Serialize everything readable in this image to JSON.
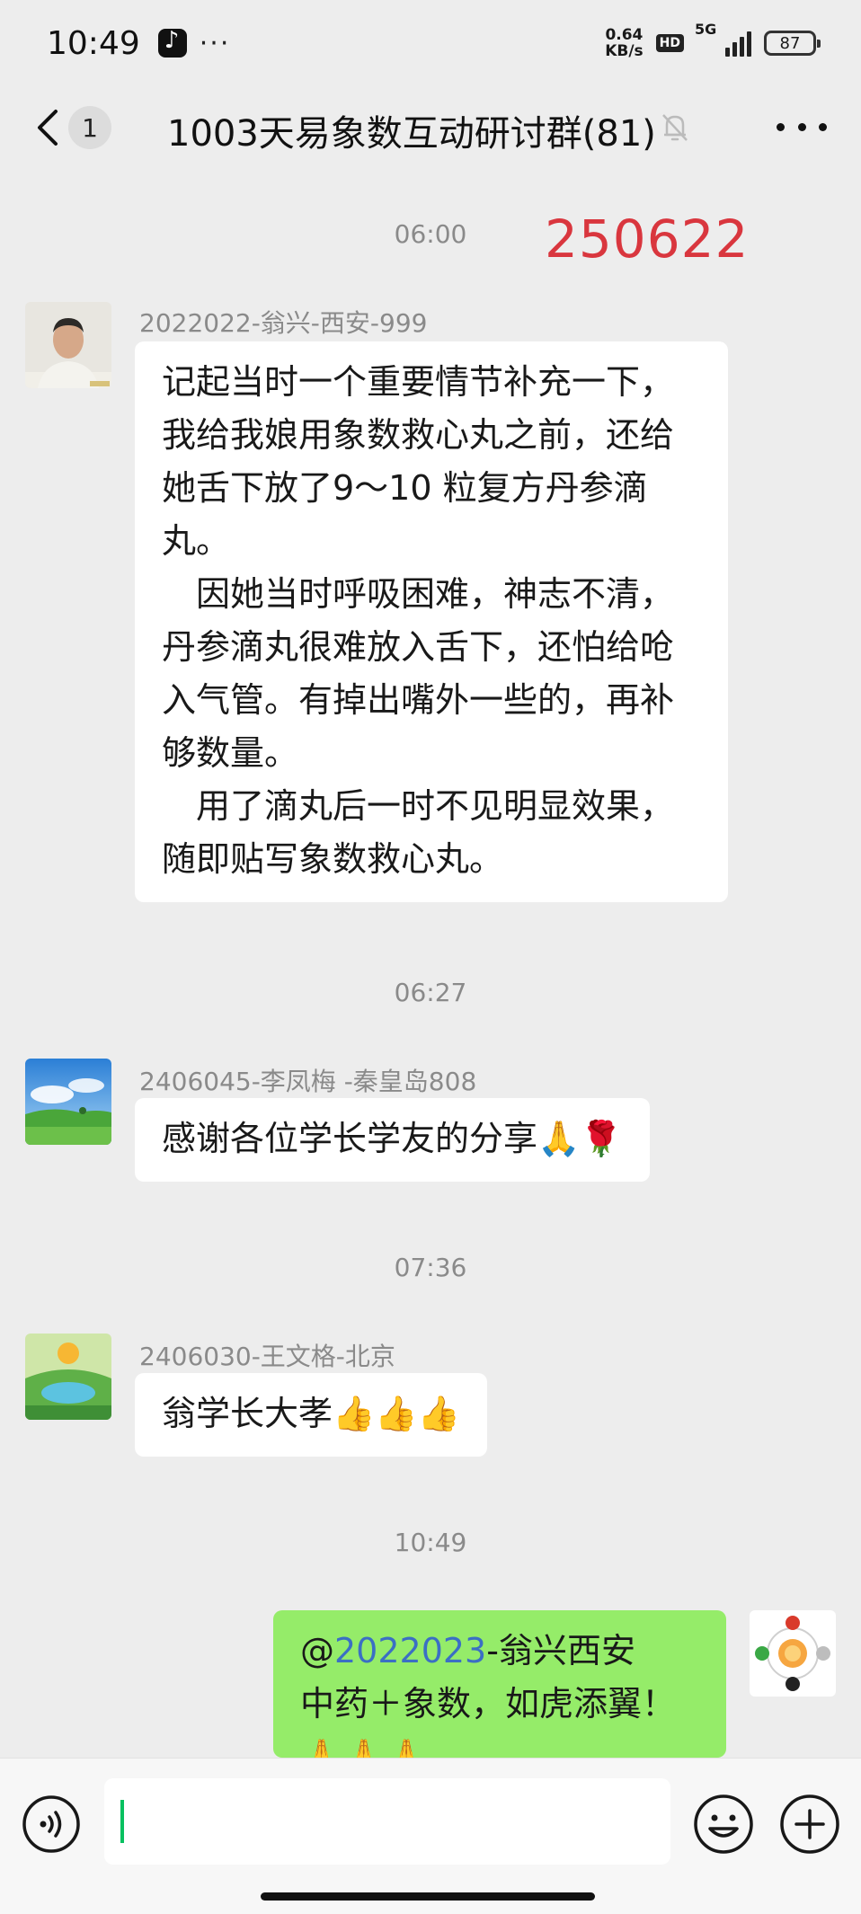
{
  "status_bar": {
    "time": "10:49",
    "dots": "···",
    "net_speed_value": "0.64",
    "net_speed_unit": "KB/s",
    "hd": "HD",
    "signal": "5G",
    "battery": "87"
  },
  "header": {
    "unread_count": "1",
    "title": "1003天易象数互动研讨群(81)"
  },
  "date_stamp": "250622",
  "messages": [
    {
      "time": "06:00",
      "sender": "2022022-翁兴-西安-999",
      "lines": [
        "记起当时一个重要情节补充一下，",
        "我给我娘用象数救心丸之前，还给",
        "她舌下放了9～10 粒复方丹参滴",
        "丸。",
        "　因她当时呼吸困难，神志不清，",
        "丹参滴丸很难放入舌下，还怕给呛",
        "入气管。有掉出嘴外一些的，再补",
        "够数量。",
        "　用了滴丸后一时不见明显效果，",
        "随即贴写象数救心丸。"
      ]
    },
    {
      "time": "06:27",
      "sender": "2406045-李凤梅 -秦皇岛808",
      "text": "感谢各位学长学友的分享",
      "emoji": "🙏🌹"
    },
    {
      "time": "07:36",
      "sender": "2406030-王文格-北京",
      "text": "翁学长大孝",
      "emoji": "👍👍👍"
    },
    {
      "time": "10:49",
      "mention_at": "@",
      "mention_name": "2022023",
      "mention_rest": "-翁兴西安",
      "line2": "中药＋象数，如虎添翼！",
      "emoji": "🙏🙏🙏"
    }
  ]
}
